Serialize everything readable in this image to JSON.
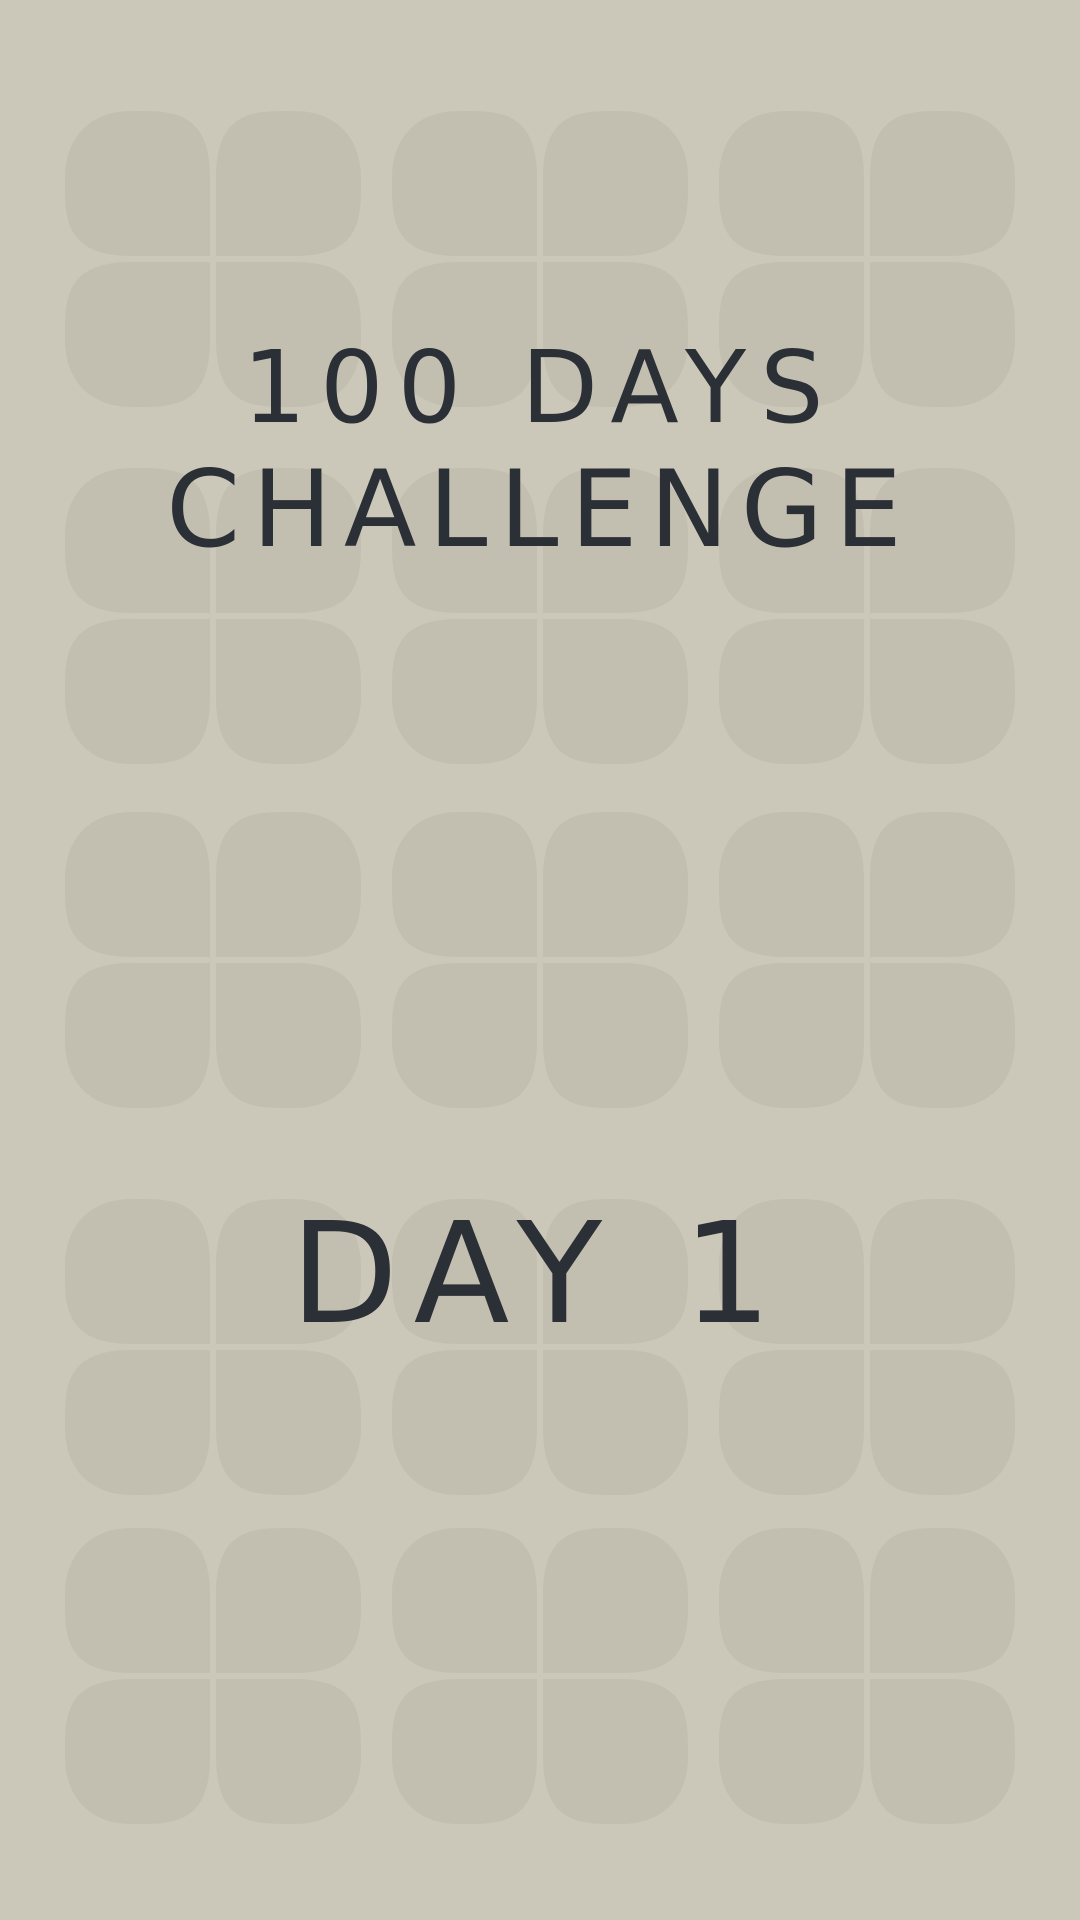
{
  "theme": {
    "background": "#CCC8B9",
    "pattern_fill": "#C3BFB0",
    "text": "#2B2F36"
  },
  "title": {
    "line1": "100 DAYS",
    "line2": "CHALLENGE"
  },
  "day": {
    "label": "DAY 1"
  }
}
